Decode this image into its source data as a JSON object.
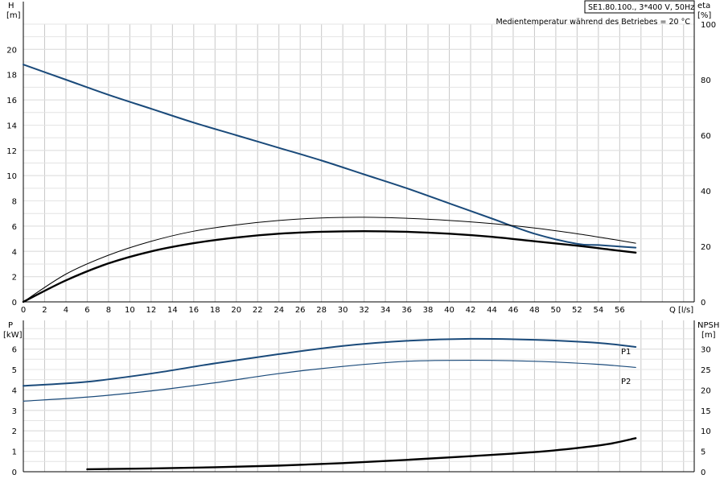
{
  "chart_data": [
    {
      "type": "line",
      "title_box": "SE1.80.100., 3*400 V, 50Hz",
      "annotation": "Medientemperatur während des Betriebes = 20 °C",
      "xlabel": "Q [l/s]",
      "xlabel_top": "Q",
      "xlabel_unit": "[l/s]",
      "y_left_label": "H",
      "y_left_unit": "[m]",
      "y_right_label": "eta",
      "y_right_unit": "[%]",
      "xlim": [
        0,
        63
      ],
      "ylim_left": [
        0,
        22
      ],
      "ylim_right": [
        0,
        100
      ],
      "x_ticks": [
        0,
        2,
        4,
        6,
        8,
        10,
        12,
        14,
        16,
        18,
        20,
        22,
        24,
        26,
        28,
        30,
        32,
        34,
        36,
        38,
        40,
        42,
        44,
        46,
        48,
        50,
        52,
        54,
        56
      ],
      "y_left_ticks": [
        0,
        2,
        4,
        6,
        8,
        10,
        12,
        14,
        16,
        18,
        20
      ],
      "y_right_ticks": [
        0,
        20,
        40,
        60,
        80,
        100
      ],
      "grid": true,
      "series": [
        {
          "axis": "left",
          "color": "#1a4a7a",
          "width": 2,
          "x": [
            0,
            4,
            8,
            12,
            16,
            20,
            24,
            28,
            32,
            36,
            40,
            44,
            48,
            52,
            54,
            57.5
          ],
          "y": [
            18.8,
            17.6,
            16.4,
            15.3,
            14.2,
            13.2,
            12.2,
            11.2,
            10.1,
            9.0,
            7.8,
            6.6,
            5.4,
            4.6,
            4.5,
            4.3
          ]
        },
        {
          "axis": "left",
          "color": "#000000",
          "width": 1,
          "x": [
            0,
            4,
            8,
            12,
            16,
            20,
            24,
            28,
            32,
            36,
            40,
            44,
            48,
            52,
            55,
            57.5
          ],
          "y": [
            0,
            2.2,
            3.7,
            4.8,
            5.6,
            6.1,
            6.45,
            6.65,
            6.7,
            6.62,
            6.45,
            6.2,
            5.85,
            5.4,
            5.0,
            4.65
          ]
        },
        {
          "axis": "left",
          "color": "#000000",
          "width": 2.4,
          "x": [
            0,
            4,
            8,
            12,
            16,
            20,
            24,
            28,
            32,
            36,
            40,
            44,
            48,
            52,
            55,
            57.5
          ],
          "y": [
            0,
            1.7,
            3.05,
            4.0,
            4.65,
            5.1,
            5.4,
            5.55,
            5.6,
            5.55,
            5.4,
            5.15,
            4.8,
            4.45,
            4.15,
            3.9
          ]
        }
      ]
    },
    {
      "type": "line",
      "xlim": [
        0,
        63
      ],
      "ylim_left": [
        0,
        7.4
      ],
      "ylim_right": [
        0,
        37
      ],
      "y_left_label": "P",
      "y_left_unit": "[kW]",
      "y_right_label": "NPSH",
      "y_right_unit": "[m]",
      "y_left_ticks": [
        0,
        1,
        2,
        3,
        4,
        5,
        6
      ],
      "y_right_ticks": [
        0,
        5,
        10,
        15,
        20,
        25,
        30
      ],
      "grid": true,
      "series": [
        {
          "name": "P1",
          "axis": "left",
          "color": "#1a4a7a",
          "width": 2,
          "x": [
            0,
            6,
            12,
            18,
            24,
            30,
            36,
            42,
            48,
            54,
            57.5
          ],
          "y": [
            4.2,
            4.4,
            4.8,
            5.3,
            5.75,
            6.15,
            6.4,
            6.5,
            6.45,
            6.3,
            6.1
          ]
        },
        {
          "name": "P2",
          "axis": "left",
          "color": "#1a4a7a",
          "width": 1.2,
          "x": [
            0,
            6,
            12,
            18,
            24,
            30,
            36,
            42,
            48,
            54,
            57.5
          ],
          "y": [
            3.45,
            3.65,
            3.95,
            4.35,
            4.8,
            5.15,
            5.4,
            5.45,
            5.4,
            5.25,
            5.1
          ]
        },
        {
          "axis": "right",
          "color": "#000000",
          "width": 2.4,
          "x": [
            6,
            12,
            18,
            24,
            30,
            36,
            42,
            48,
            52,
            55,
            57.5
          ],
          "y": [
            0.6,
            0.8,
            1.1,
            1.5,
            2.1,
            2.9,
            3.8,
            4.8,
            5.8,
            6.8,
            8.2
          ]
        }
      ]
    }
  ]
}
